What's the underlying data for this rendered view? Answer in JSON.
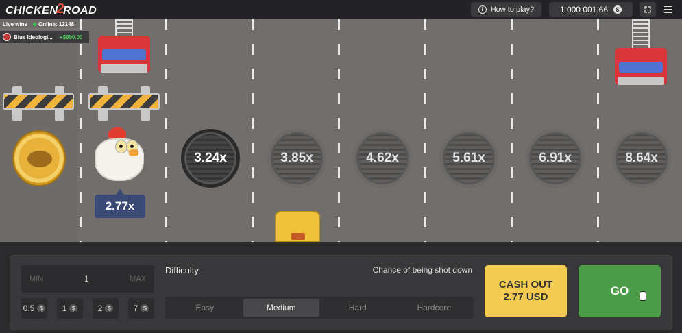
{
  "header": {
    "logo_left": "CHICKEN",
    "logo_number": "2",
    "logo_right": "ROAD",
    "how_to_play": "How to play?",
    "balance": "1 000 001.66",
    "currency_symbol": "$"
  },
  "live": {
    "label": "Live wins",
    "online": "Online: 12148",
    "winner_name": "Blue Ideologi...",
    "winner_amount": "+$690.00"
  },
  "game": {
    "chicken_multiplier": "2.77x",
    "multipliers": [
      "3.24x",
      "3.85x",
      "4.62x",
      "5.61x",
      "6.91x",
      "8.64x"
    ],
    "active_multiplier_index": 0
  },
  "bet": {
    "min_label": "MIN",
    "value": "1",
    "max_label": "MAX",
    "chips": [
      "0.5",
      "1",
      "2",
      "7"
    ],
    "chip_symbol": "$"
  },
  "difficulty": {
    "label": "Difficulty",
    "chance_label": "Chance of being shot down",
    "options": [
      "Easy",
      "Medium",
      "Hard",
      "Hardcore"
    ],
    "selected": "Medium"
  },
  "actions": {
    "cashout_line1": "CASH OUT",
    "cashout_line2": "2.77 USD",
    "go": "GO"
  },
  "colors": {
    "road": "#716e6c",
    "cashout": "#f3cb52",
    "go": "#4c9b48",
    "active_tab": "#48484b"
  }
}
